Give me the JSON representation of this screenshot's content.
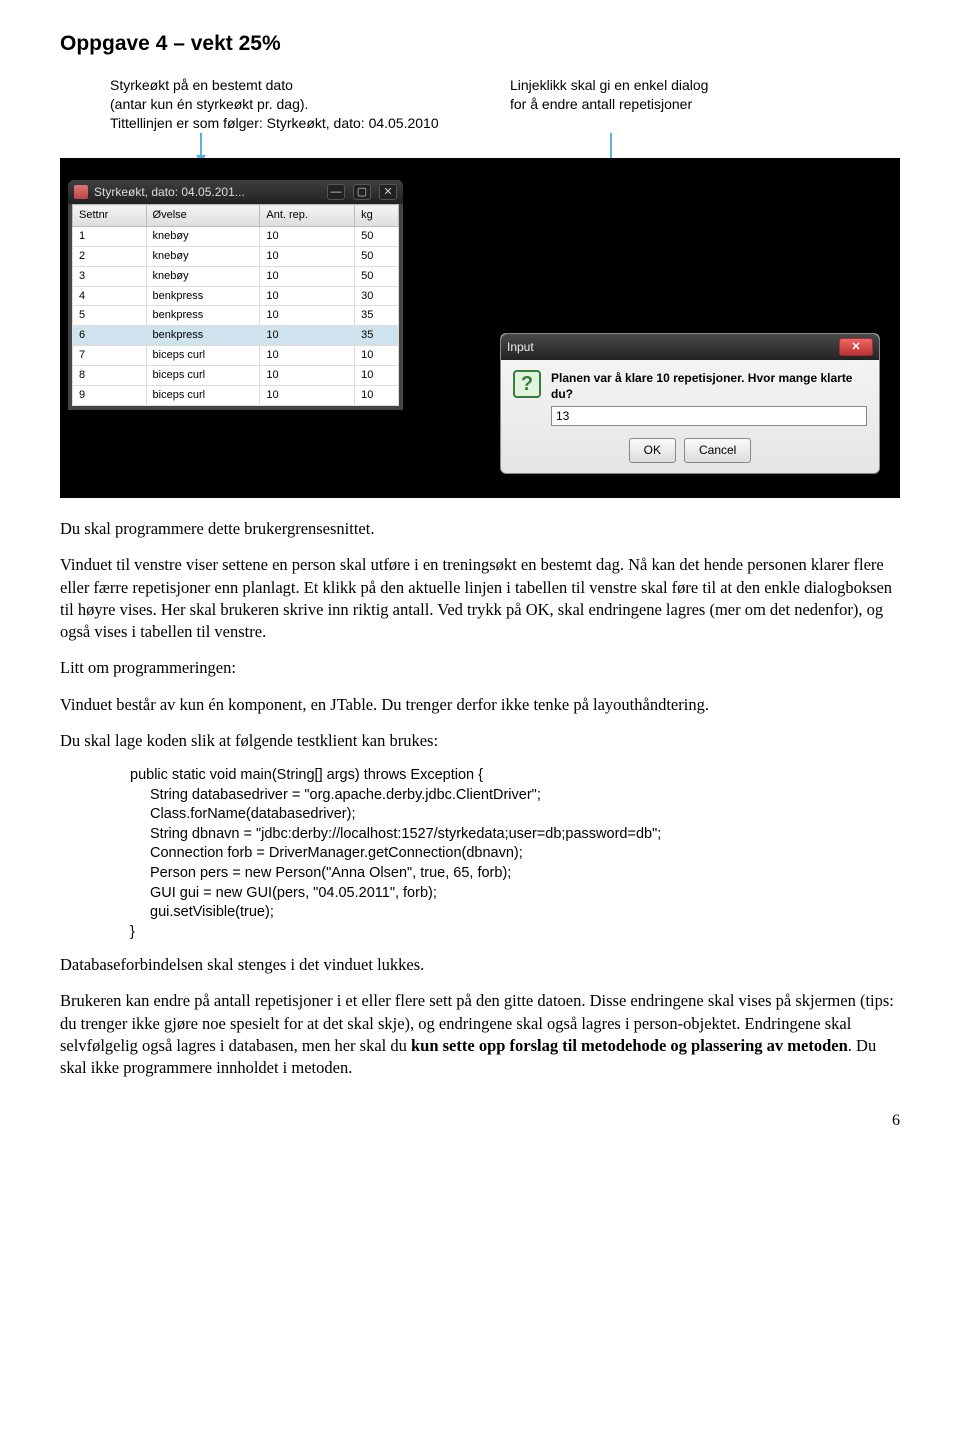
{
  "title": "Oppgave 4 – vekt 25%",
  "annotation_left": {
    "l1": "Styrkeøkt på en bestemt dato",
    "l2": "(antar kun én styrkeøkt pr. dag).",
    "l3": "Tittellinjen er som følger: Styrkeøkt, dato: 04.05.2010"
  },
  "annotation_right": {
    "l1": "Linjeklikk skal gi en enkel dialog",
    "l2": "for å endre antall repetisjoner"
  },
  "window": {
    "title": "Styrkeøkt, dato: 04.05.201...",
    "headers": [
      "Settnr",
      "Øvelse",
      "Ant. rep.",
      "kg"
    ],
    "rows": [
      [
        "1",
        "knebøy",
        "10",
        "50"
      ],
      [
        "2",
        "knebøy",
        "10",
        "50"
      ],
      [
        "3",
        "knebøy",
        "10",
        "50"
      ],
      [
        "4",
        "benkpress",
        "10",
        "30"
      ],
      [
        "5",
        "benkpress",
        "10",
        "35"
      ],
      [
        "6",
        "benkpress",
        "10",
        "35"
      ],
      [
        "7",
        "biceps curl",
        "10",
        "10"
      ],
      [
        "8",
        "biceps curl",
        "10",
        "10"
      ],
      [
        "9",
        "biceps curl",
        "10",
        "10"
      ]
    ],
    "selected_row_index": 5
  },
  "dialog": {
    "title": "Input",
    "message": "Planen var å klare 10 repetisjoner. Hvor mange klarte du?",
    "value": "13",
    "ok": "OK",
    "cancel": "Cancel"
  },
  "para1": "Du skal programmere dette brukergrensesnittet.",
  "para2": "Vinduet til venstre viser settene en person skal utføre i en treningsøkt en bestemt dag. Nå kan det hende personen klarer flere eller færre repetisjoner enn planlagt. Et klikk på den aktuelle linjen i tabellen til venstre skal føre til at den enkle dialogboksen til høyre vises. Her skal brukeren skrive inn riktig antall. Ved trykk på OK, skal endringene lagres (mer om det nedenfor), og også vises i tabellen til venstre.",
  "para3": "Litt om programmeringen:",
  "para4": "Vinduet består av kun én komponent, en JTable. Du trenger derfor ikke tenke på layouthåndtering.",
  "para5": "Du skal lage koden slik at følgende testklient kan brukes:",
  "code": {
    "l1": "public static void main(String[] args) throws Exception {",
    "l2": "String databasedriver = \"org.apache.derby.jdbc.ClientDriver\";",
    "l3": "Class.forName(databasedriver);",
    "l4": "String dbnavn = \"jdbc:derby://localhost:1527/styrkedata;user=db;password=db\";",
    "l5": "Connection forb = DriverManager.getConnection(dbnavn);",
    "l6": "Person pers = new Person(\"Anna Olsen\", true, 65, forb);",
    "l7": "GUI gui = new GUI(pers, \"04.05.2011\", forb);",
    "l8": "gui.setVisible(true);",
    "l9": "}"
  },
  "para6": "Databaseforbindelsen skal stenges i det vinduet lukkes.",
  "para7_a": "Brukeren kan endre på antall repetisjoner i et eller flere sett på den gitte datoen. Disse endringene skal vises på skjermen (tips: du trenger ikke gjøre noe spesielt for at det skal skje), og endringene skal også lagres i person-objektet. Endringene skal selvfølgelig også lagres i databasen, men her skal du ",
  "para7_b": "kun sette opp forslag til metodehode og plassering av metoden",
  "para7_c": ". Du skal ikke programmere innholdet i metoden.",
  "page_number": "6"
}
